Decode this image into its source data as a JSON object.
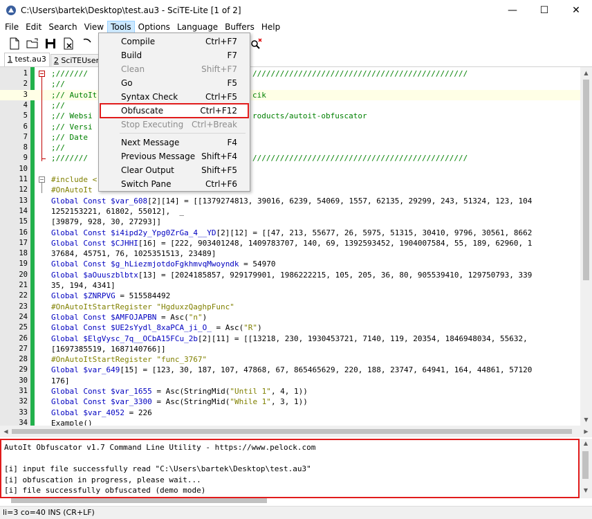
{
  "window": {
    "title": "C:\\Users\\bartek\\Desktop\\test.au3 - SciTE-Lite [1 of 2]",
    "minimize": "—",
    "maximize": "☐",
    "close": "✕"
  },
  "menu": [
    "File",
    "Edit",
    "Search",
    "View",
    "Tools",
    "Options",
    "Language",
    "Buffers",
    "Help"
  ],
  "toolbar": {
    "icons": [
      "new-file-icon",
      "open-folder-icon",
      "save-icon",
      "close-file-icon",
      "print-icon",
      "find-icon",
      "find-replace-icon"
    ]
  },
  "tabs": [
    {
      "num": "1",
      "label": " test.au3"
    },
    {
      "num": "2",
      "label": " SciTEUser.prop"
    }
  ],
  "tools_menu": [
    {
      "label": "Compile",
      "shortcut": "Ctrl+F7",
      "enabled": true
    },
    {
      "label": "Build",
      "shortcut": "F7",
      "enabled": true
    },
    {
      "label": "Clean",
      "shortcut": "Shift+F7",
      "enabled": false
    },
    {
      "label": "Go",
      "shortcut": "F5",
      "enabled": true
    },
    {
      "label": "Syntax Check",
      "shortcut": "Ctrl+F5",
      "enabled": true
    },
    {
      "label": "Obfuscate",
      "shortcut": "Ctrl+F12",
      "enabled": true
    },
    {
      "label": "Stop Executing",
      "shortcut": "Ctrl+Break",
      "enabled": false
    },
    {
      "label": "Next Message",
      "shortcut": "F4",
      "enabled": true
    },
    {
      "label": "Previous Message",
      "shortcut": "Shift+F4",
      "enabled": true
    },
    {
      "label": "Clear Output",
      "shortcut": "Shift+F5",
      "enabled": true
    },
    {
      "label": "Switch Pane",
      "shortcut": "Ctrl+F6",
      "enabled": true
    }
  ],
  "editor": {
    "lines": [
      {
        "n": "1",
        "text": ";///////",
        "tail": "///////////////////////////////////////////////",
        "type": "comment"
      },
      {
        "n": "2",
        "text": ";//",
        "tail": "",
        "type": "comment"
      },
      {
        "n": "3",
        "text": ";// AutoIt",
        "tail": "cik",
        "type": "comment"
      },
      {
        "n": "4",
        "text": ";//",
        "tail": "",
        "type": "comment"
      },
      {
        "n": "5",
        "text": ";// Websi",
        "tail": "roducts/autoit-obfuscator",
        "type": "comment"
      },
      {
        "n": "6",
        "text": ";// Versi",
        "tail": "",
        "type": "comment"
      },
      {
        "n": "7",
        "text": ";// Date",
        "tail": "",
        "type": "comment"
      },
      {
        "n": "8",
        "text": ";//",
        "tail": "",
        "type": "comment"
      },
      {
        "n": "9",
        "text": ";///////",
        "tail": "///////////////////////////////////////////////",
        "type": "comment"
      },
      {
        "n": "10",
        "text": "",
        "tail": "",
        "type": "plain"
      },
      {
        "n": "11",
        "text": "#include <",
        "tail": "",
        "type": "directive"
      },
      {
        "n": "12",
        "text": "#OnAutoIt",
        "tail": "",
        "type": "directive"
      },
      {
        "n": "13",
        "text": "Global Const $var_608[2][14] = [[1379274813, 39016, 6239, 54069, 1557, 62135, 29299, 243, 51324, 123, 104",
        "tail": "",
        "type": "code"
      },
      {
        "n": "14",
        "text": "1252153221, 61802, 55012],  _",
        "tail": "",
        "type": "code"
      },
      {
        "n": "15",
        "text": "[39879, 928, 30, 27293]]",
        "tail": "",
        "type": "code"
      },
      {
        "n": "16",
        "text": "Global Const $i4ipd2y_Ypg0ZrGa_4__YD[2][12] = [[47, 213, 55677, 26, 5975, 51315, 30410, 9796, 30561, 8662",
        "tail": "",
        "type": "code"
      },
      {
        "n": "17",
        "text": "Global Const $CJHHI[16] = [222, 903401248, 1409783707, 140, 69, 1392593452, 1904007584, 55, 189, 62960, 1",
        "tail": "",
        "type": "code"
      },
      {
        "n": "18",
        "text": "37684, 45751, 76, 1025351513, 23489]",
        "tail": "",
        "type": "code"
      },
      {
        "n": "19",
        "text": "Global Const $g_hLiezmjotdoFgkhmvqMwoyndk = 54970",
        "tail": "",
        "type": "code"
      },
      {
        "n": "20",
        "text": "Global $aOuuszblbtx[13] = [2024185857, 929179901, 1986222215, 105, 205, 36, 80, 905539410, 129750793, 339",
        "tail": "",
        "type": "code"
      },
      {
        "n": "21",
        "text": "35, 194, 4341]",
        "tail": "",
        "type": "code"
      },
      {
        "n": "22",
        "text": "Global $ZNRPVG = 515584492",
        "tail": "",
        "type": "code"
      },
      {
        "n": "23",
        "text": "#OnAutoItStartRegister \"HgduxzQaghpFunc\"",
        "tail": "",
        "type": "directive"
      },
      {
        "n": "24",
        "text": "Global Const $AMFOJAPBN = Asc(\"n\")",
        "tail": "",
        "type": "code"
      },
      {
        "n": "25",
        "text": "Global Const $UE2sYydl_8xaPCA_ji_O_ = Asc(\"R\")",
        "tail": "",
        "type": "code"
      },
      {
        "n": "26",
        "text": "Global $ElgVysc_7q__OCbA15FCu_2b[2][11] = [[13218, 230, 1930453721, 7140, 119, 20354, 1846948034, 55632,",
        "tail": "",
        "type": "code"
      },
      {
        "n": "27",
        "text": "[1697385519, 1687140766]]",
        "tail": "",
        "type": "code"
      },
      {
        "n": "28",
        "text": "#OnAutoItStartRegister \"func_3767\"",
        "tail": "",
        "type": "directive"
      },
      {
        "n": "29",
        "text": "Global $var_649[15] = [123, 30, 187, 107, 47868, 67, 865465629, 220, 188, 23747, 64941, 164, 44861, 57120",
        "tail": "",
        "type": "code"
      },
      {
        "n": "30",
        "text": "176]",
        "tail": "",
        "type": "code"
      },
      {
        "n": "31",
        "text": "Global Const $var_1655 = Asc(StringMid(\"Until 1\", 4, 1))",
        "tail": "",
        "type": "code"
      },
      {
        "n": "32",
        "text": "Global Const $var_3300 = Asc(StringMid(\"While 1\", 3, 1))",
        "tail": "",
        "type": "code"
      },
      {
        "n": "33",
        "text": "Global $var_4052 = 226",
        "tail": "",
        "type": "code"
      },
      {
        "n": "34",
        "text": "Example()",
        "tail": "",
        "type": "code"
      }
    ]
  },
  "output": {
    "lines": [
      "AutoIt Obfuscator v1.7 Command Line Utility - https://www.pelock.com",
      "",
      "[i] input file successfully read \"C:\\Users\\bartek\\Desktop\\test.au3\"",
      "[i] obfuscation in progress, please wait...",
      "[i] file successfully obfuscated (demo mode)"
    ]
  },
  "status": "li=3 co=40 INS (CR+LF)",
  "colors": {
    "highlight_red": "#e11b1b",
    "change_bar": "#22b14c",
    "comment": "#008000",
    "menu_active": "#cce8ff"
  }
}
